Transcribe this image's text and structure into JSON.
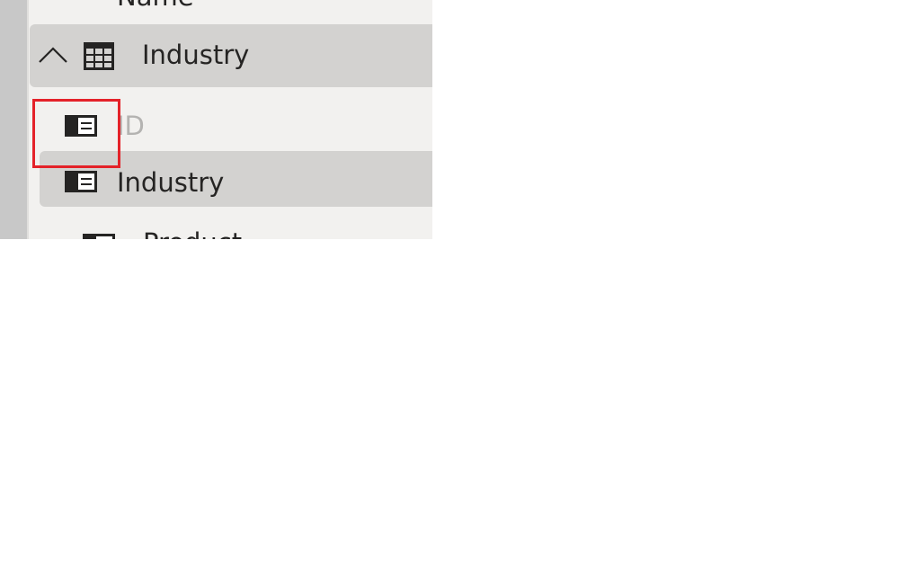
{
  "fields_pane": {
    "rows": [
      {
        "label": "Name",
        "type": "field",
        "icon": "field-icon",
        "state": "normal",
        "clipped": true
      },
      {
        "label": "Industry",
        "type": "table",
        "icon": "table-icon",
        "expand_icon": "chevron-up-icon",
        "expanded": true,
        "state": "selected"
      },
      {
        "label": "ID",
        "type": "field",
        "icon": "field-icon",
        "state": "disabled",
        "highlighted": true
      },
      {
        "label": "Industry",
        "type": "field",
        "icon": "field-icon",
        "state": "selected"
      },
      {
        "label": "Product",
        "type": "field",
        "icon": "field-icon",
        "state": "normal",
        "clipped": true
      }
    ]
  },
  "colors": {
    "pane_background": "#f2f1ef",
    "selected_row": "#d3d2d0",
    "text": "#252423",
    "disabled_text": "#b4b3b1",
    "highlight_border": "#e42229",
    "scrollbar": "#c8c8c8"
  }
}
